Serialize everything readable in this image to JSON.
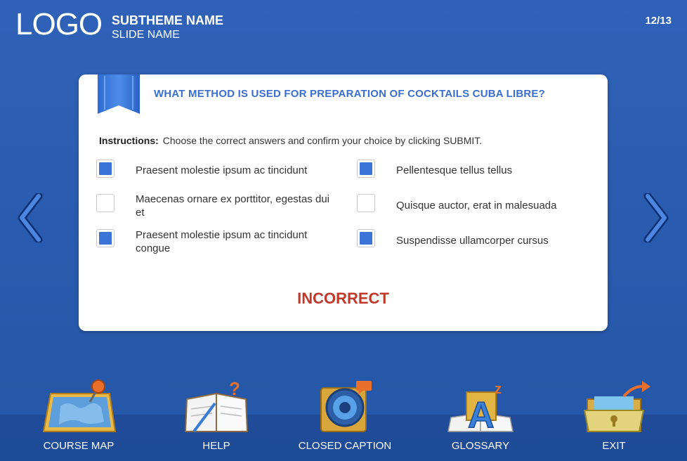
{
  "header": {
    "logo": "LOGO",
    "subtheme": "SUBTHEME NAME",
    "slide_name": "SLIDE NAME",
    "page_counter": "12/13"
  },
  "question": {
    "title": "WHAT METHOD IS USED FOR PREPARATION OF COCKTAILS CUBA LIBRE?",
    "instructions_label": "Instructions:",
    "instructions_text": "Choose the correct answers and confirm your choice by clicking SUBMIT.",
    "options": [
      {
        "label": "Praesent molestie ipsum ac tincidunt",
        "checked": true
      },
      {
        "label": "Pellentesque tellus tellus",
        "checked": true
      },
      {
        "label": "Maecenas ornare ex porttitor, egestas dui et",
        "checked": false
      },
      {
        "label": "Quisque auctor, erat in malesuada",
        "checked": false
      },
      {
        "label": "Praesent molestie ipsum ac tincidunt congue",
        "checked": true
      },
      {
        "label": "Suspendisse ullamcorper cursus",
        "checked": true
      }
    ],
    "result": "INCORRECT"
  },
  "toolbar": {
    "course_map": "COURSE MAP",
    "help": "HELP",
    "closed_caption": "CLOSED CAPTION",
    "glossary": "GLOSSARY",
    "exit": "EXIT"
  },
  "colors": {
    "accent": "#3a6fd0",
    "checkbox_fill": "#3b74d6",
    "result_incorrect": "#c0392b",
    "background": "#2a5aad"
  },
  "icons": [
    "chevron-left-icon",
    "chevron-right-icon",
    "ribbon-bookmark-icon",
    "course-map-icon",
    "help-notebook-icon",
    "closed-caption-icon",
    "glossary-icon",
    "exit-folder-icon"
  ]
}
